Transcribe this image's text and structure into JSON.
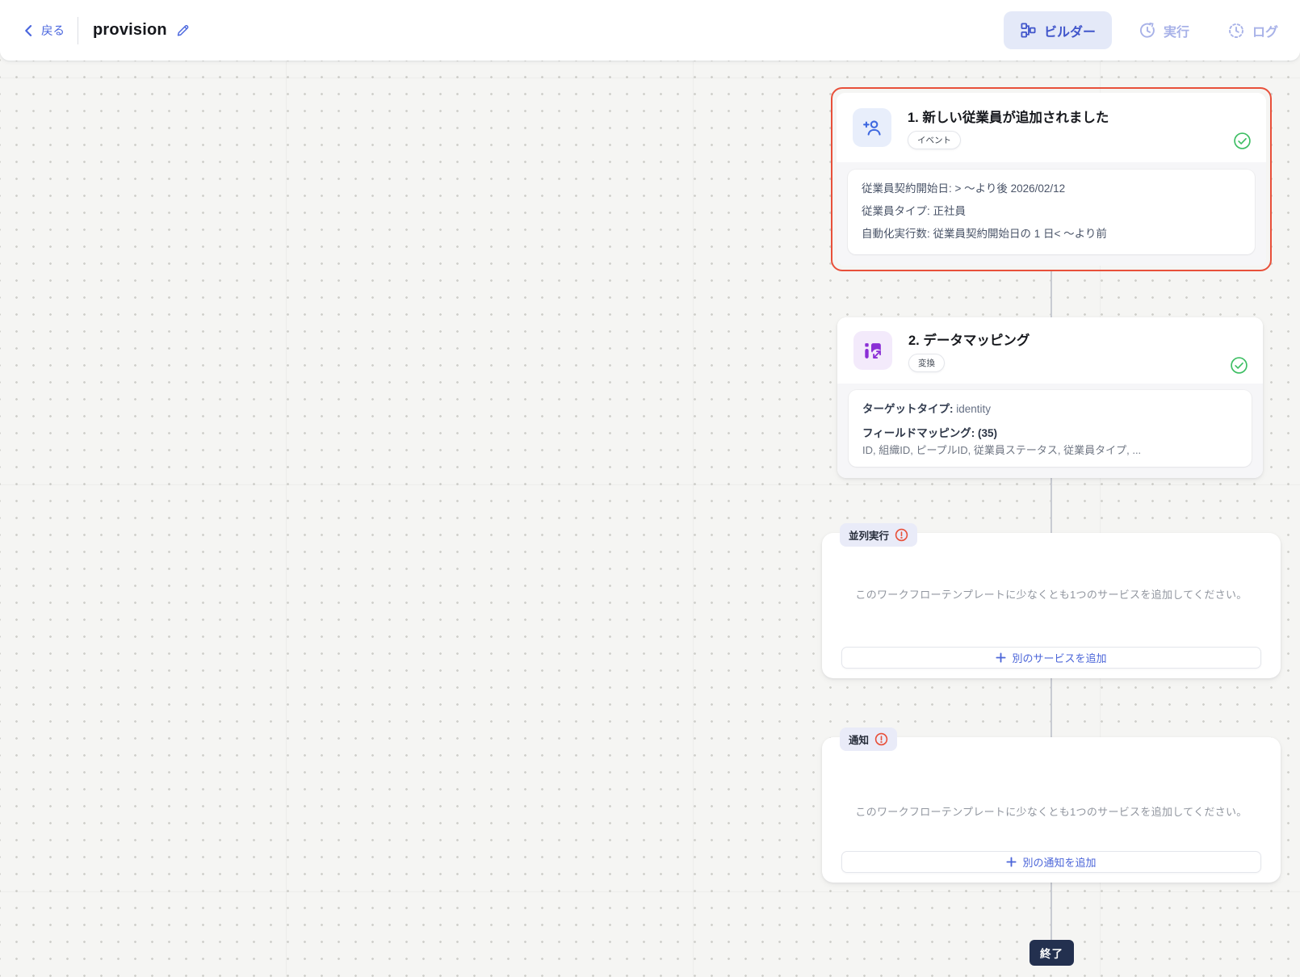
{
  "header": {
    "back": "戻る",
    "title": "provision",
    "tabs": {
      "builder": "ビルダー",
      "run": "実行",
      "logs": "ログ"
    }
  },
  "canvas": {
    "steps": {
      "event": {
        "title": "1. 新しい従業員が追加されました",
        "badge": "イベント",
        "details": [
          "従業員契約開始日: > 〜より後 2026/02/12",
          "従業員タイプ: 正社員",
          "自動化実行数: 従業員契約開始日の 1 日< 〜より前"
        ]
      },
      "mapping": {
        "title": "2. データマッピング",
        "badge": "変換",
        "target_type_label": "ターゲットタイプ:",
        "target_type_value": "identity",
        "field_mapping_label": "フィールドマッピング: (35)",
        "field_mapping_preview": "ID, 組織ID, ピープルID, 従業員ステータス, 従業員タイプ, ..."
      },
      "parallel": {
        "tag": "並列実行",
        "message": "このワークフローテンプレートに少なくとも1つのサービスを追加してください。",
        "add_button": "別のサービスを追加"
      },
      "notification": {
        "tag": "通知",
        "message": "このワークフローテンプレートに少なくとも1つのサービスを追加してください。",
        "add_button": "別の通知を追加"
      }
    },
    "end_badge": "終了"
  },
  "colors": {
    "accent_blue": "#4a66de",
    "builder_tab_bg": "#e4e9f8",
    "disabled_lavender": "#a8b2e8",
    "selection_red": "#e8503a",
    "success_green": "#3dbe63",
    "warning_orange": "#e8503a",
    "event_icon_blue": "#3e68e0",
    "mapping_icon_purple": "#8b2fd6",
    "end_badge_navy": "#23304f",
    "canvas_bg": "#f5f5f3"
  }
}
